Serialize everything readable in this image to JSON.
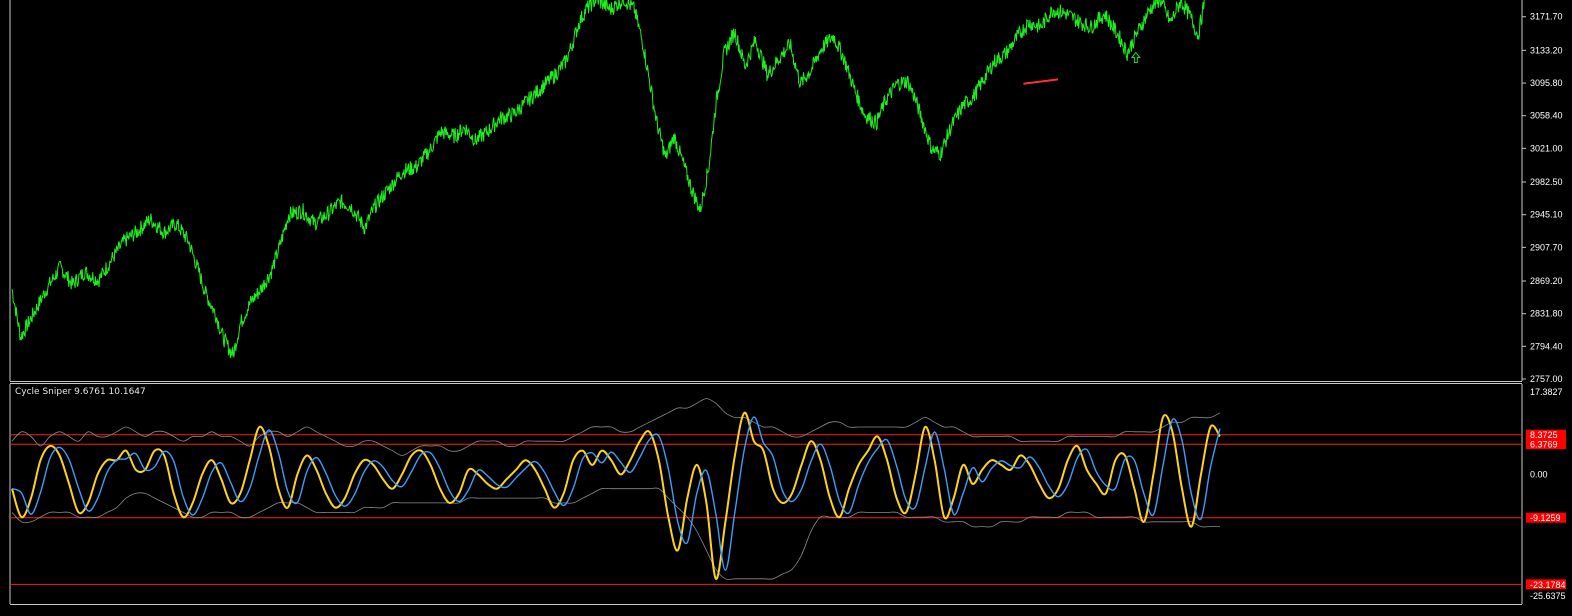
{
  "colors": {
    "background": "#000000",
    "price_line": "#1cf01c",
    "axis_text": "#ffffff",
    "frame": "#c8c8c8",
    "cycle_fast": "#ffd21e",
    "cycle_slow": "#3c9cff",
    "band": "#8c8c8c",
    "level_line": "#ff1c1c",
    "level_badge": "#ff0000",
    "trend_marker": "#ff3030",
    "arrow_marker": "#20e020"
  },
  "indicator": {
    "title": "Cycle Sniper 9.6761 10.1647"
  },
  "chart_data": [
    {
      "type": "line",
      "name": "price-chart",
      "y_ticks": [
        "3171.70",
        "3133.20",
        "3095.80",
        "3058.40",
        "3021.00",
        "2982.50",
        "2945.10",
        "2907.70",
        "2869.20",
        "2831.80",
        "2794.40",
        "2757.00"
      ],
      "ylim": [
        2757.0,
        3192.0
      ],
      "grid": false,
      "points": [
        [
          0,
          2860
        ],
        [
          5,
          2805
        ],
        [
          12,
          2830
        ],
        [
          20,
          2860
        ],
        [
          28,
          2885
        ],
        [
          35,
          2865
        ],
        [
          42,
          2880
        ],
        [
          50,
          2870
        ],
        [
          58,
          2895
        ],
        [
          65,
          2915
        ],
        [
          72,
          2925
        ],
        [
          80,
          2940
        ],
        [
          88,
          2925
        ],
        [
          95,
          2935
        ],
        [
          102,
          2915
        ],
        [
          108,
          2880
        ],
        [
          112,
          2855
        ],
        [
          118,
          2830
        ],
        [
          122,
          2805
        ],
        [
          126,
          2790
        ],
        [
          128,
          2785
        ],
        [
          132,
          2820
        ],
        [
          138,
          2845
        ],
        [
          144,
          2860
        ],
        [
          150,
          2880
        ],
        [
          155,
          2910
        ],
        [
          160,
          2945
        ],
        [
          168,
          2950
        ],
        [
          175,
          2935
        ],
        [
          182,
          2945
        ],
        [
          190,
          2960
        ],
        [
          196,
          2955
        ],
        [
          204,
          2930
        ],
        [
          210,
          2955
        ],
        [
          218,
          2975
        ],
        [
          226,
          2995
        ],
        [
          234,
          3000
        ],
        [
          242,
          3020
        ],
        [
          248,
          3040
        ],
        [
          256,
          3035
        ],
        [
          262,
          3045
        ],
        [
          268,
          3030
        ],
        [
          275,
          3040
        ],
        [
          282,
          3055
        ],
        [
          290,
          3060
        ],
        [
          298,
          3075
        ],
        [
          306,
          3090
        ],
        [
          314,
          3105
        ],
        [
          320,
          3120
        ],
        [
          324,
          3140
        ],
        [
          328,
          3165
        ],
        [
          332,
          3180
        ],
        [
          338,
          3192
        ],
        [
          346,
          3180
        ],
        [
          354,
          3192
        ],
        [
          360,
          3180
        ],
        [
          365,
          3140
        ],
        [
          369,
          3095
        ],
        [
          373,
          3050
        ],
        [
          378,
          3010
        ],
        [
          383,
          3035
        ],
        [
          388,
          3005
        ],
        [
          393,
          2975
        ],
        [
          398,
          2950
        ],
        [
          403,
          3000
        ],
        [
          407,
          3070
        ],
        [
          412,
          3130
        ],
        [
          418,
          3155
        ],
        [
          424,
          3115
        ],
        [
          430,
          3145
        ],
        [
          437,
          3105
        ],
        [
          444,
          3125
        ],
        [
          450,
          3140
        ],
        [
          456,
          3095
        ],
        [
          462,
          3110
        ],
        [
          468,
          3135
        ],
        [
          475,
          3150
        ],
        [
          481,
          3125
        ],
        [
          487,
          3090
        ],
        [
          493,
          3060
        ],
        [
          500,
          3050
        ],
        [
          505,
          3075
        ],
        [
          512,
          3095
        ],
        [
          518,
          3098
        ],
        [
          522,
          3080
        ],
        [
          527,
          3050
        ],
        [
          532,
          3020
        ],
        [
          537,
          3015
        ],
        [
          543,
          3045
        ],
        [
          550,
          3070
        ],
        [
          556,
          3080
        ],
        [
          562,
          3100
        ],
        [
          568,
          3120
        ],
        [
          575,
          3130
        ],
        [
          582,
          3150
        ],
        [
          588,
          3165
        ],
        [
          595,
          3160
        ],
        [
          602,
          3180
        ],
        [
          610,
          3175
        ],
        [
          618,
          3165
        ],
        [
          624,
          3160
        ],
        [
          632,
          3175
        ],
        [
          640,
          3150
        ],
        [
          645,
          3130
        ],
        [
          650,
          3150
        ],
        [
          658,
          3180
        ],
        [
          664,
          3192
        ],
        [
          670,
          3165
        ],
        [
          676,
          3190
        ],
        [
          682,
          3170
        ],
        [
          686,
          3150
        ],
        [
          690,
          3192
        ]
      ],
      "trend_marker": [
        [
          585,
          3095
        ],
        [
          605,
          3100
        ]
      ],
      "arrow_marker": [
        650,
        3125
      ]
    },
    {
      "type": "line",
      "name": "cycle-sniper",
      "y_ticks": [
        "17.3827",
        "0.00",
        "-25.6375"
      ],
      "ylim": [
        -25.6375,
        17.3827
      ],
      "grid": false,
      "levels": [
        {
          "label": "8.3725",
          "value": 8.3725
        },
        {
          "label": "6.3769",
          "value": 6.3769
        },
        {
          "label": "-9.1259",
          "value": -9.1259
        },
        {
          "label": "-23.1784",
          "value": -23.1784
        }
      ],
      "series": [
        {
          "values": [
            -3,
            -9,
            -5,
            3,
            6,
            4,
            -2,
            -8,
            -6,
            0,
            3,
            3,
            5,
            1,
            1,
            5,
            4,
            -4,
            -9,
            -6,
            0,
            3,
            -1,
            -6,
            -4,
            3,
            10,
            6,
            -3,
            -7,
            0,
            4,
            1,
            -4,
            -7,
            -5,
            0,
            3,
            2,
            -1,
            -3,
            0,
            4,
            5,
            2,
            -3,
            -6,
            -4,
            1,
            0,
            -2,
            -3,
            -1,
            1,
            3,
            1,
            -3,
            -7,
            -4,
            3,
            5,
            2,
            5,
            3,
            0,
            3,
            7,
            9,
            3,
            -9,
            -16,
            -5,
            2,
            -6,
            -22,
            -10,
            4,
            13,
            7,
            5,
            -3,
            -6,
            -4,
            2,
            7,
            3,
            -5,
            -9,
            -3,
            2,
            5,
            8,
            3,
            -5,
            -8,
            0,
            10,
            3,
            -9,
            -5,
            2,
            -2,
            1,
            3,
            2,
            1,
            4,
            2,
            -2,
            -5,
            -3,
            3,
            6,
            1,
            -2,
            -4,
            3,
            4,
            -3,
            -10,
            0,
            12,
            9,
            -3,
            -11,
            0,
            10,
            8
          ]
        },
        {
          "values": [
            -3,
            -9,
            -5,
            3,
            6,
            4,
            -2,
            -8,
            -6,
            0,
            3,
            3,
            5,
            1,
            1,
            5,
            4,
            -4,
            -9,
            -6,
            0,
            3,
            -1,
            -6,
            -4,
            3,
            10,
            6,
            -3,
            -7,
            0,
            4,
            1,
            -4,
            -7,
            -5,
            0,
            3,
            2,
            -1,
            -3,
            0,
            4,
            5,
            2,
            -3,
            -6,
            -4,
            1,
            0,
            -2,
            -3,
            -1,
            1,
            3,
            1,
            -3,
            -7,
            -4,
            3,
            5,
            2,
            5,
            3,
            0,
            3,
            7,
            9,
            3,
            -9,
            -16,
            -5,
            2,
            -6,
            -22,
            -10,
            4,
            13,
            7,
            5,
            -3,
            -6,
            -4,
            2,
            7,
            3,
            -5,
            -9,
            -3,
            2,
            5,
            8,
            3,
            -5,
            -8,
            0,
            10,
            3,
            -9,
            -5,
            2,
            -2,
            1,
            3,
            2,
            1,
            4,
            2,
            -2,
            -5,
            -3,
            3,
            6,
            1,
            -2,
            -4,
            3,
            4,
            -3,
            -10,
            0,
            12,
            9,
            -3,
            -11,
            0,
            10,
            8
          ]
        },
        {
          "values": [
            7,
            9,
            8,
            6,
            8,
            9,
            8,
            7,
            9,
            8,
            8,
            9,
            10,
            9,
            8,
            9,
            9,
            8,
            7,
            8,
            8,
            9,
            8,
            8,
            7,
            6,
            8,
            9,
            9,
            8,
            9,
            10,
            9,
            8,
            7,
            6,
            6,
            7,
            7,
            6,
            5,
            4,
            5,
            6,
            6,
            6,
            5,
            5,
            6,
            7,
            7,
            7,
            6,
            6,
            7,
            7,
            7,
            7,
            7,
            8,
            9,
            10,
            10,
            10,
            9,
            9,
            10,
            11,
            12,
            13,
            14,
            14,
            15,
            16,
            15,
            13,
            12,
            12,
            11,
            10,
            10,
            9,
            8,
            8,
            9,
            10,
            11,
            11,
            10,
            10,
            10,
            10,
            10,
            10,
            10,
            11,
            12,
            11,
            10,
            10,
            9,
            8,
            8,
            8,
            8,
            8,
            7,
            7,
            7,
            7,
            7,
            8,
            8,
            8,
            8,
            8,
            8,
            9,
            9,
            9,
            9,
            10,
            11,
            11,
            12,
            12,
            12,
            13
          ]
        },
        {
          "values": [
            -8,
            -10,
            -10,
            -9,
            -8,
            -8,
            -8,
            -9,
            -9,
            -9,
            -8,
            -7,
            -5,
            -4,
            -4,
            -5,
            -6,
            -7,
            -8,
            -9,
            -9,
            -8,
            -8,
            -8,
            -9,
            -9,
            -8,
            -7,
            -6,
            -6,
            -6,
            -7,
            -8,
            -8,
            -8,
            -8,
            -8,
            -7,
            -7,
            -7,
            -6,
            -6,
            -6,
            -6,
            -6,
            -6,
            -6,
            -6,
            -5,
            -5,
            -5,
            -5,
            -5,
            -5,
            -5,
            -5,
            -5,
            -6,
            -6,
            -6,
            -5,
            -4,
            -3,
            -3,
            -3,
            -3,
            -3,
            -3,
            -3,
            -5,
            -7,
            -9,
            -12,
            -16,
            -20,
            -22,
            -22,
            -22,
            -22,
            -22,
            -22,
            -21,
            -20,
            -17,
            -12,
            -9,
            -9,
            -9,
            -9,
            -8,
            -8,
            -8,
            -8,
            -8,
            -9,
            -9,
            -9,
            -9,
            -10,
            -10,
            -10,
            -11,
            -11,
            -11,
            -10,
            -10,
            -10,
            -9,
            -9,
            -9,
            -9,
            -8,
            -8,
            -8,
            -9,
            -9,
            -9,
            -9,
            -9,
            -10,
            -10,
            -10,
            -10,
            -10,
            -10,
            -11,
            -11,
            -11
          ]
        }
      ]
    }
  ]
}
